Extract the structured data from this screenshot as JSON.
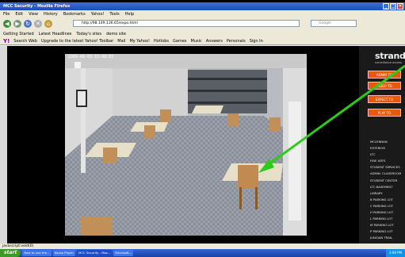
{
  "window": {
    "title": "MCC Security - Mozilla Firefox"
  },
  "menu": [
    "File",
    "Edit",
    "View",
    "History",
    "Bookmarks",
    "Yahoo!",
    "Tools",
    "Help"
  ],
  "nav": {
    "url": "http://98.149.136.65/expo.html",
    "search_placeholder": "Google"
  },
  "bookmarks": [
    "Getting Started",
    "Latest Headlines",
    "Today's sites",
    "demo site"
  ],
  "yahoo_toolbar": {
    "logo": "Y!",
    "search_label": "Search Web",
    "items": [
      "Upgrade to the latest Yahoo! Toolbar",
      "Mail",
      "My Yahoo!",
      "Hotlobs",
      "Games",
      "Music",
      "Answers",
      "Personals",
      "Sign In"
    ]
  },
  "camera": {
    "timestamp": "2009-08-03 15:08:03"
  },
  "panel": {
    "logo": "strand",
    "logo_sub": "surveillance access",
    "buttons": [
      "ADMIN TO",
      "VIDEO TO",
      "EXPECT TO",
      "PLAY TO"
    ],
    "locations": [
      "MCLENNAN",
      "EXTERIOR",
      "LTC",
      "FINE ARTS",
      "STUDENT SERVICES",
      "ADMIN. CLASSROOM",
      "STUDENT CENTER",
      "LTC BASEMENT",
      "LIBRARY",
      "B PARKING LOT",
      "C PARKING LOT",
      "H PARKING LOT",
      "L PARKING LOT",
      "M PARKING LOT",
      "P PARKING LOT",
      "JUNGIAN TRAIL",
      "NEW PARKING LOT"
    ]
  },
  "status": {
    "text": "javascript:void(0)"
  },
  "taskbar": {
    "start": "start",
    "tasks": [
      "How to use the...",
      "Kazaa Player",
      "MCC Security - Moz...",
      "Microsoft..."
    ],
    "clock": "3:08 PM"
  },
  "colors": {
    "titlebar": "#1c4eb8",
    "panel_button": "#e8590c",
    "arrow": "#2ecc1a",
    "taskbar": "#245edb"
  }
}
